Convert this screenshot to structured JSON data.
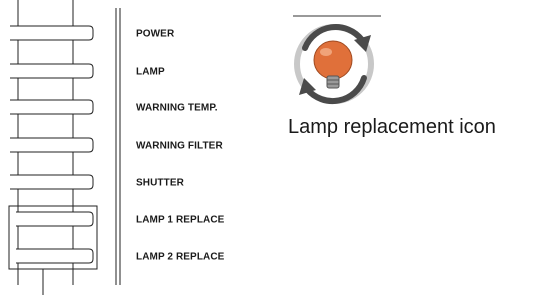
{
  "indicators": [
    {
      "label": "POWER"
    },
    {
      "label": "LAMP"
    },
    {
      "label": "WARNING TEMP."
    },
    {
      "label": "WARNING FILTER"
    },
    {
      "label": "SHUTTER"
    },
    {
      "label": "LAMP 1 REPLACE"
    },
    {
      "label": "LAMP 2 REPLACE"
    }
  ],
  "icon": {
    "name": "lamp-replacement-icon",
    "caption": "Lamp replacement icon",
    "colors": {
      "bulb": "#e0703a",
      "ring": "#4a4a4a",
      "ring_light": "#c8c8c8"
    }
  }
}
